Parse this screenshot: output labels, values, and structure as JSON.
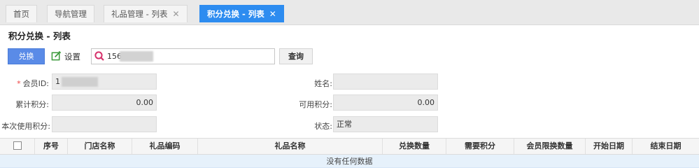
{
  "tabs": [
    {
      "label": "首页",
      "closable": false,
      "active": false
    },
    {
      "label": "导航管理",
      "closable": false,
      "active": false
    },
    {
      "label": "礼品管理 - 列表",
      "closable": true,
      "active": false
    },
    {
      "label": "积分兑换 - 列表",
      "closable": true,
      "active": true
    }
  ],
  "close_glyph": "✕",
  "page": {
    "title": "积分兑换 - 列表"
  },
  "toolbar": {
    "exchange_label": "兑换",
    "settings_label": "设置",
    "search_value": "156",
    "query_label": "查询"
  },
  "form": {
    "member_id": {
      "label": "会员ID:",
      "value": "1",
      "required_mark": "*"
    },
    "name": {
      "label": "姓名:",
      "value": ""
    },
    "total_points": {
      "label": "累计积分:",
      "value": "0.00"
    },
    "available_points": {
      "label": "可用积分:",
      "value": "0.00"
    },
    "use_points": {
      "label": "本次使用积分:",
      "value": ""
    },
    "status": {
      "label": "状态:",
      "value": "正常"
    }
  },
  "table": {
    "columns": [
      "序号",
      "门店名称",
      "礼品编码",
      "礼品名称",
      "兑换数量",
      "需要积分",
      "会员限换数量",
      "开始日期",
      "结束日期"
    ],
    "empty_text": "没有任何数据"
  },
  "colors": {
    "accent": "#2d8cf0",
    "button_blue": "#5a8be7",
    "search_icon": "#d6336c",
    "settings_icon": "#3a9a3a",
    "empty_row": "#e6f1fb"
  }
}
